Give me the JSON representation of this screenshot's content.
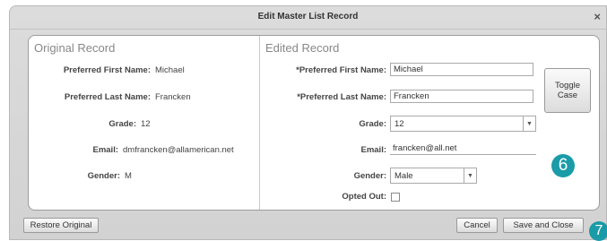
{
  "dialog": {
    "title": "Edit Master List Record",
    "close_glyph": "×"
  },
  "original": {
    "heading": "Original Record",
    "rows": [
      {
        "label": "Preferred First Name:",
        "value": "Michael"
      },
      {
        "label": "Preferred Last Name:",
        "value": "Francken"
      },
      {
        "label": "Grade:",
        "value": "12"
      },
      {
        "label": "Email:",
        "value": "dmfrancken@allamerican.net"
      },
      {
        "label": "Gender:",
        "value": "M"
      }
    ]
  },
  "edited": {
    "heading": "Edited Record",
    "first_name": {
      "label": "*Preferred First Name:",
      "value": "Michael"
    },
    "last_name": {
      "label": "*Preferred Last Name:",
      "value": "Francken"
    },
    "grade": {
      "label": "Grade:",
      "value": "12"
    },
    "email": {
      "label": "Email:",
      "value": "francken@all.net"
    },
    "gender": {
      "label": "Gender:",
      "value": "Male"
    },
    "opted_out": {
      "label": "Opted Out:",
      "checked": false
    },
    "toggle_case_label": "Toggle Case"
  },
  "footer": {
    "restore_label": "Restore Original",
    "cancel_label": "Cancel",
    "save_close_label": "Save and Close"
  },
  "badges": {
    "six": "6",
    "seven": "7"
  },
  "colors": {
    "badge": "#1a9ba8"
  }
}
